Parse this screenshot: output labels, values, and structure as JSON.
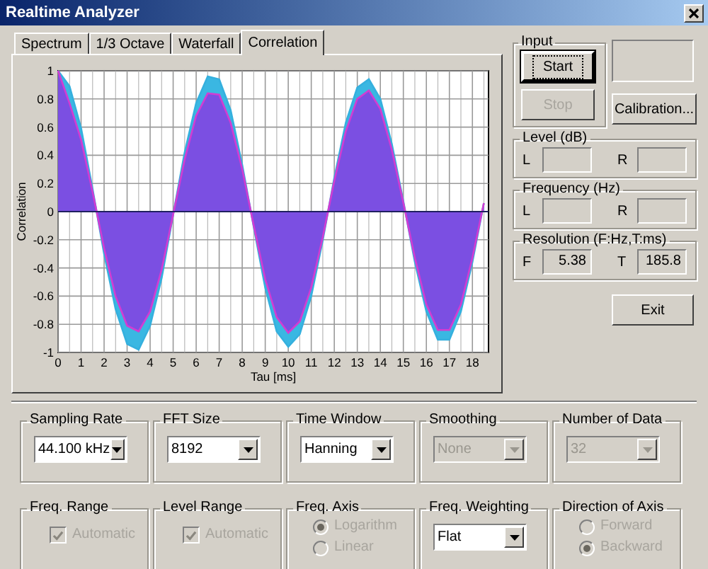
{
  "window": {
    "title": "Realtime Analyzer"
  },
  "tabs": [
    {
      "label": "Spectrum",
      "selected": false
    },
    {
      "label": "1/3 Octave",
      "selected": false
    },
    {
      "label": "Waterfall",
      "selected": false
    },
    {
      "label": "Correlation",
      "selected": true
    }
  ],
  "chart": {
    "chart_data": {
      "type": "area",
      "grid": true,
      "xlabel": "Tau [ms]",
      "ylabel": "Correlation",
      "x": [
        0,
        0.5,
        1,
        1.5,
        2,
        2.5,
        3,
        3.5,
        4,
        4.5,
        5,
        5.5,
        6,
        6.5,
        7,
        7.5,
        8,
        8.5,
        9,
        9.5,
        10,
        10.5,
        11,
        11.5,
        12,
        12.5,
        13,
        13.5,
        14,
        14.5,
        15,
        15.5,
        16,
        16.5,
        17,
        17.5,
        18,
        18.5
      ],
      "xlim": [
        0,
        18.7
      ],
      "ylim": [
        -1,
        1
      ],
      "xticks": [
        0,
        1,
        2,
        3,
        4,
        5,
        6,
        7,
        8,
        9,
        10,
        11,
        12,
        13,
        14,
        15,
        16,
        17,
        18
      ],
      "yticks": [
        {
          "value": -1,
          "label": "-1"
        },
        {
          "value": -0.8,
          "label": "-0.8"
        },
        {
          "value": -0.6,
          "label": "-0.6"
        },
        {
          "value": -0.4,
          "label": "-0.4"
        },
        {
          "value": -0.2,
          "label": "-0.2"
        },
        {
          "value": 0,
          "label": "0"
        },
        {
          "value": 0.2,
          "label": "0.2"
        },
        {
          "value": 0.4,
          "label": "0.4"
        },
        {
          "value": 0.6,
          "label": "0.6"
        },
        {
          "value": 0.8,
          "label": "0.8"
        },
        {
          "value": 1,
          "label": "1"
        }
      ],
      "series": [
        {
          "color": "#35b0de",
          "values": [
            1,
            0.89,
            0.59,
            0.16,
            -0.3,
            -0.69,
            -0.94,
            -0.98,
            -0.81,
            -0.47,
            -0.02,
            0.42,
            0.77,
            0.96,
            0.94,
            0.72,
            0.33,
            -0.11,
            -0.54,
            -0.85,
            -0.96,
            -0.87,
            -0.6,
            -0.2,
            0.24,
            0.63,
            0.88,
            0.94,
            0.8,
            0.48,
            0.07,
            -0.36,
            -0.71,
            -0.91,
            -0.91,
            -0.71,
            -0.36,
            0.06
          ]
        },
        {
          "color": "#d23cd2",
          "values": [
            1,
            0.77,
            0.51,
            0.14,
            -0.26,
            -0.6,
            -0.81,
            -0.85,
            -0.71,
            -0.41,
            -0.02,
            0.37,
            0.68,
            0.84,
            0.83,
            0.63,
            0.3,
            -0.1,
            -0.48,
            -0.75,
            -0.86,
            -0.78,
            -0.54,
            -0.18,
            0.22,
            0.57,
            0.8,
            0.86,
            0.73,
            0.44,
            0.06,
            -0.33,
            -0.66,
            -0.84,
            -0.84,
            -0.66,
            -0.33,
            0.06
          ]
        }
      ]
    }
  },
  "input": {
    "title": "Input",
    "buttons": [
      {
        "label": "Start",
        "disabled": false,
        "focused": true
      },
      {
        "label": "Stop",
        "disabled": true,
        "focused": false
      }
    ],
    "calibration_button": "Calibration..."
  },
  "level": {
    "title": "Level (dB)",
    "fields": [
      {
        "label": "L"
      },
      {
        "label": "R"
      }
    ]
  },
  "frequency": {
    "title": "Frequency (Hz)",
    "fields": [
      {
        "label": "L"
      },
      {
        "label": "R"
      }
    ]
  },
  "resolution": {
    "title": "Resolution (F:Hz,T:ms)",
    "fields": [
      {
        "label": "F",
        "value": "5.38"
      },
      {
        "label": "T",
        "value": "185.8"
      }
    ]
  },
  "exit_button": "Exit",
  "settings_row_1": [
    {
      "title": "Sampling Rate",
      "kind": "select",
      "value": "44.100 kHz",
      "disabled": false
    },
    {
      "title": "FFT Size",
      "kind": "select",
      "value": "8192",
      "disabled": false
    },
    {
      "title": "Time Window",
      "kind": "select",
      "value": "Hanning",
      "disabled": false
    },
    {
      "title": "Smoothing",
      "kind": "select",
      "value": "None",
      "disabled": true
    },
    {
      "title": "Number of Data",
      "kind": "select",
      "value": "32",
      "disabled": true
    }
  ],
  "settings_row_2": [
    {
      "title": "Freq. Range",
      "kind": "checkbox",
      "label": "Automatic",
      "checked": true,
      "disabled": true
    },
    {
      "title": "Level Range",
      "kind": "checkbox",
      "label": "Automatic",
      "checked": true,
      "disabled": true
    },
    {
      "title": "Freq. Axis",
      "kind": "radio",
      "disabled": true,
      "options": [
        {
          "label": "Logarithm",
          "selected": true
        },
        {
          "label": "Linear",
          "selected": false
        }
      ]
    },
    {
      "title": "Freq. Weighting",
      "kind": "select",
      "value": "Flat",
      "disabled": false
    },
    {
      "title": "Direction of Axis",
      "kind": "radio",
      "disabled": true,
      "options": [
        {
          "label": "Forward",
          "selected": false
        },
        {
          "label": "Backward",
          "selected": true
        }
      ]
    }
  ]
}
